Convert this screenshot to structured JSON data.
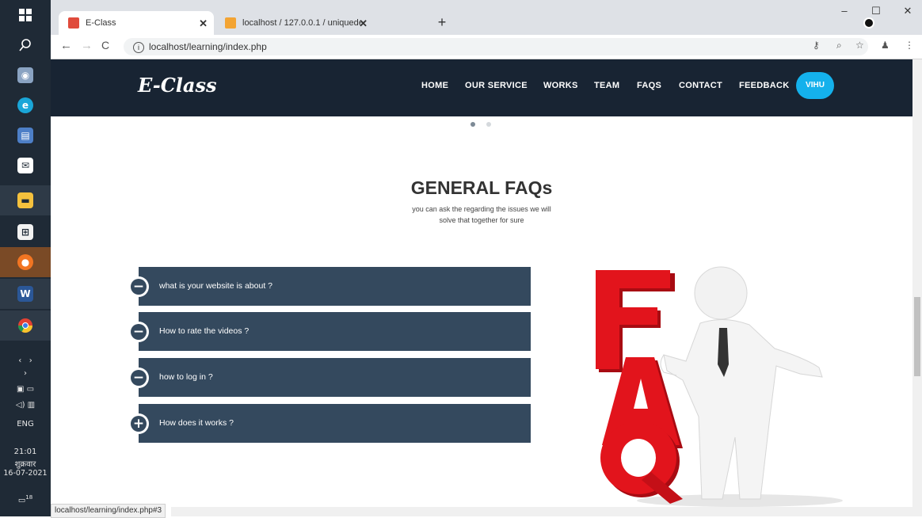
{
  "taskbar": {
    "icons": [
      "windows-start-icon",
      "search-icon",
      "camera-icon",
      "edge-icon",
      "remote-icon",
      "mail-icon",
      "file-explorer-icon",
      "store-icon",
      "firefox-icon",
      "word-icon",
      "chrome-icon",
      "notification-icon"
    ],
    "tray": {
      "language": "ENG",
      "time": "21:01",
      "day": "शुक्रवार",
      "date": "16-07-2021",
      "notif_count": "18"
    }
  },
  "browser": {
    "tabs": [
      {
        "title": "E-Class"
      },
      {
        "title": "localhost / 127.0.0.1 / uniquede"
      }
    ],
    "url": "localhost/learning/index.php",
    "status_url": "localhost/learning/index.php#3"
  },
  "site": {
    "logo": "E-Class",
    "nav": [
      "HOME",
      "OUR SERVICE",
      "WORKS",
      "TEAM",
      "FAQS",
      "CONTACT",
      "FEEDBACK"
    ],
    "user": "VIHU",
    "faq": {
      "title": "GENERAL FAQs",
      "subtitle_line1": "you can ask the regarding the issues we will",
      "subtitle_line2": "solve that together for sure",
      "items": [
        {
          "question": "what is your website is about ?",
          "state": "expanded"
        },
        {
          "question": "How to rate the videos ?",
          "state": "expanded"
        },
        {
          "question": "how to log in ?",
          "state": "expanded"
        },
        {
          "question": "How does it works ?",
          "state": "collapsed"
        }
      ],
      "illustration_text": "FAQ"
    }
  },
  "colors": {
    "navbar": "#182433",
    "accent": "#14b1ec",
    "faq_item": "#34495e",
    "faq_letters": "#e2141c"
  }
}
